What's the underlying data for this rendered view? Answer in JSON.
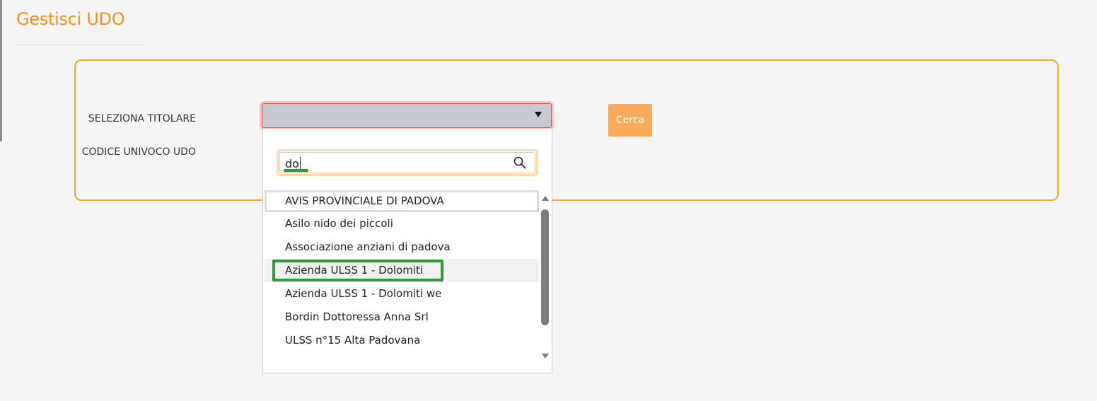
{
  "page": {
    "title": "Gestisci UDO"
  },
  "form": {
    "titolare_label": "SELEZIONA TITOLARE",
    "codice_label": "CODICE UNIVOCO UDO",
    "titolare_value": "",
    "search_button_label": "Cerca"
  },
  "dropdown": {
    "search_value": "do",
    "options": [
      "AVIS PROVINCIALE DI PADOVA",
      "Asilo nido dei piccoli",
      "Associazione anziani di padova",
      "Azienda ULSS 1 - Dolomiti",
      "Azienda ULSS 1 - Dolomiti we",
      "Bordin Dottoressa Anna Srl",
      "ULSS n°15 Alta Padovana"
    ],
    "focused_option_index": 0,
    "hovered_option_index": 3,
    "highlighted_option_index": 3,
    "icons": {
      "search": "search-icon",
      "select_toggle": "triangle-down-icon",
      "scroll_up": "triangle-up-icon",
      "scroll_down": "triangle-down-icon"
    }
  },
  "colors": {
    "accent": "#f39015",
    "panel_border": "#f5a623",
    "button": "#fbab5a",
    "error_border": "#d9534f",
    "annotation": "#2a9d3a"
  }
}
